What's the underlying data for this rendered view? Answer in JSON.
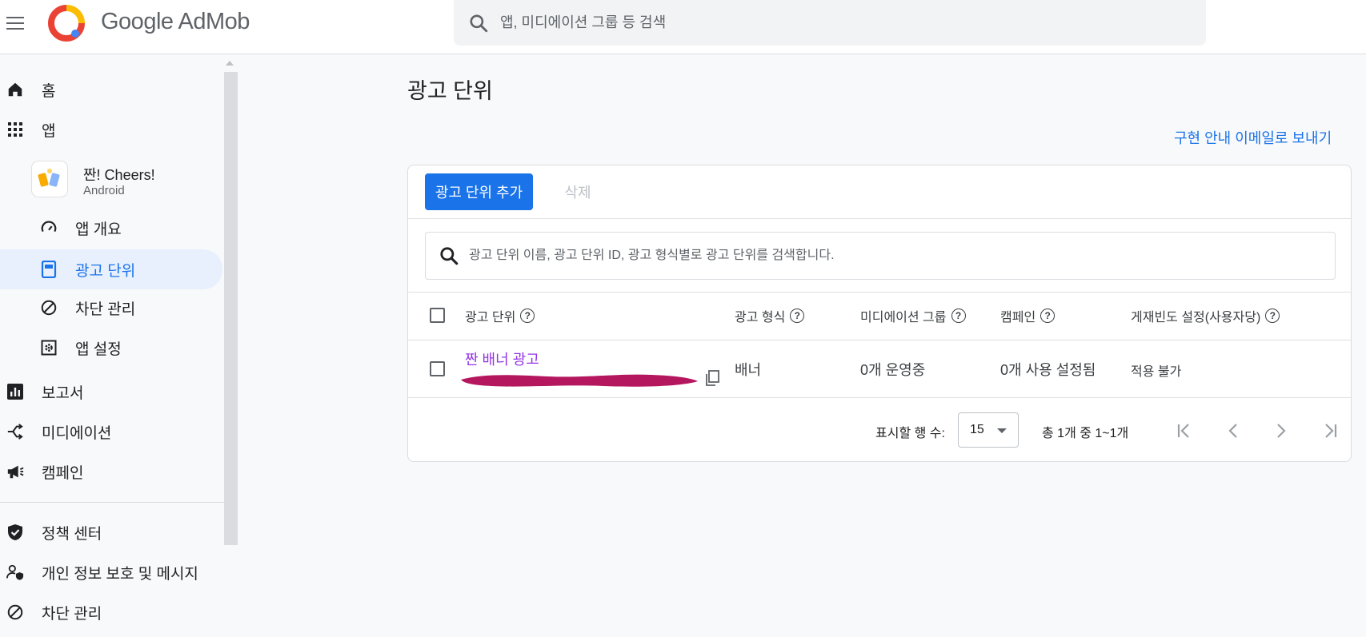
{
  "header": {
    "brand": "Google AdMob",
    "search_placeholder": "앱, 미디에이션 그룹 등 검색"
  },
  "sidebar": {
    "home": "홈",
    "apps": "앱",
    "app": {
      "name": "짠! Cheers!",
      "platform": "Android"
    },
    "app_overview": "앱 개요",
    "ad_units": "광고 단위",
    "blocking_controls": "차단 관리",
    "app_settings": "앱 설정",
    "reports": "보고서",
    "mediation": "미디에이션",
    "campaigns": "캠페인",
    "policy_center": "정책 센터",
    "privacy_messaging": "개인 정보 보호 및 메시지",
    "blocking_controls_2": "차단 관리"
  },
  "main": {
    "title": "광고 단위",
    "email_link": "구현 안내 이메일로 보내기",
    "add_button": "광고 단위 추가",
    "delete_button": "삭제",
    "table_search_placeholder": "광고 단위 이름, 광고 단위 ID, 광고 형식별로 광고 단위를 검색합니다.",
    "columns": {
      "ad_unit": "광고 단위",
      "format": "광고 형식",
      "mediation_group": "미디에이션 그룹",
      "campaigns": "캠페인",
      "frequency_cap": "게재빈도 설정(사용자당)"
    },
    "rows": [
      {
        "name": "짠 배너 광고",
        "format": "배너",
        "mediation_group": "0개 운영중",
        "campaigns": "0개 사용 설정됨",
        "frequency_cap": "적용 불가"
      }
    ],
    "pagination": {
      "rows_label": "표시할 행 수:",
      "rows_value": "15",
      "range": "총 1개 중 1~1개"
    }
  },
  "colors": {
    "primary": "#1a73e8",
    "link_visited": "#9334e6",
    "redaction": "#b5175f",
    "active_bg": "#e8f0fe"
  }
}
